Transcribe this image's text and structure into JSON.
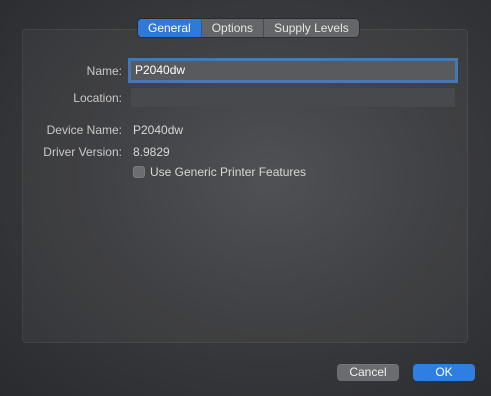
{
  "tabs": {
    "general": "General",
    "options": "Options",
    "supply_levels": "Supply Levels"
  },
  "form": {
    "name_label": "Name:",
    "name_value": "P2040dw",
    "location_label": "Location:",
    "location_value": "",
    "device_name_label": "Device Name:",
    "device_name_value": "P2040dw",
    "driver_version_label": "Driver Version:",
    "driver_version_value": "8.9829",
    "generic_features_label": "Use Generic Printer Features",
    "generic_features_checked": false
  },
  "buttons": {
    "cancel": "Cancel",
    "ok": "OK"
  },
  "colors": {
    "accent": "#2f7fe3",
    "background": "#3a3b3e"
  }
}
